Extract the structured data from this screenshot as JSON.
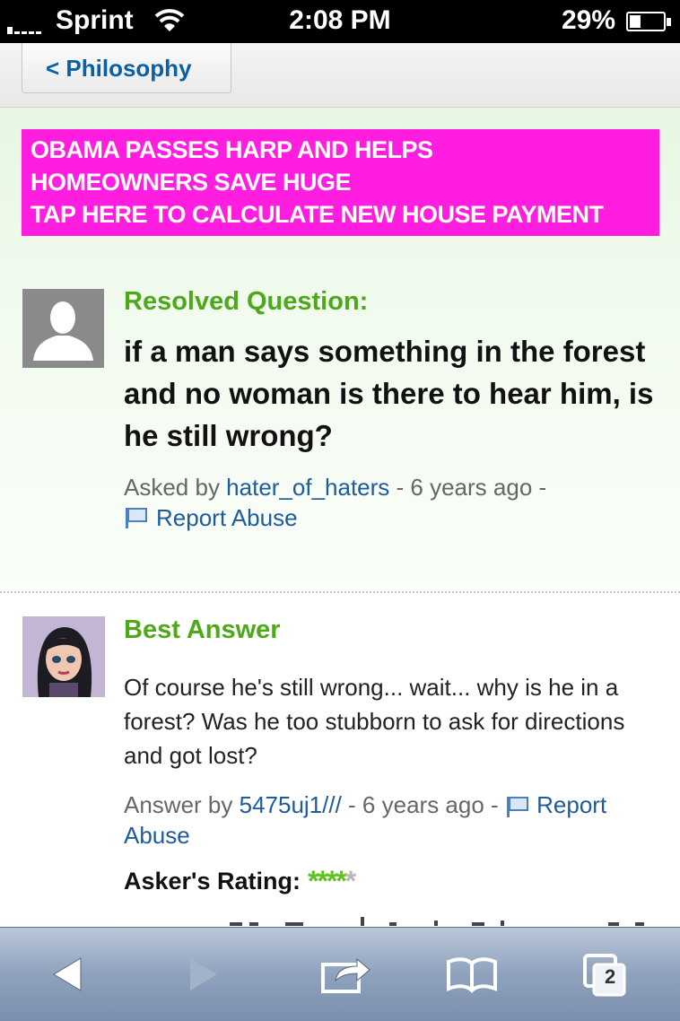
{
  "status_bar": {
    "carrier": "Sprint",
    "time": "2:08 PM",
    "battery": "29%"
  },
  "nav": {
    "back_label": "< Philosophy"
  },
  "ad": {
    "lines": [
      "OBAMA PASSES HARP AND HELPS",
      "HOMEOWNERS SAVE HUGE",
      "TAP HERE TO CALCULATE NEW HOUSE PAYMENT"
    ]
  },
  "question": {
    "status_label": "Resolved Question:",
    "title": "if a man says something in the forest and no woman is there to hear him, is he still wrong?",
    "asked_prefix": "Asked by ",
    "asker": "hater_of_haters",
    "asked_suffix": " - 6 years ago -",
    "report_label": "Report Abuse"
  },
  "answer": {
    "label": "Best Answer",
    "text": "Of course he's still wrong... wait... why is he in a forest? Was he too stubborn to ask for directions and got lost?",
    "answer_prefix": "Answer by ",
    "answerer": "5475uj1///",
    "answer_suffix": " - 6 years ago - ",
    "report_label": "Report Abuse",
    "rating_label": "Asker's Rating:",
    "rating_filled_stars": "****",
    "rating_empty_stars": "*",
    "rating_value": 4,
    "rating_max": 5
  },
  "toolbar": {
    "tab_count": "2"
  },
  "colors": {
    "accent_green": "#4fa819",
    "link_blue": "#1d5b9c",
    "ad_magenta": "#ff1ee0",
    "star_green": "#5fc21f"
  },
  "icons": [
    "signal-icon",
    "wifi-icon",
    "battery-icon",
    "person-placeholder-icon",
    "flag-icon",
    "back-arrow-icon",
    "forward-arrow-icon",
    "share-icon",
    "bookmarks-icon",
    "tabs-icon"
  ]
}
